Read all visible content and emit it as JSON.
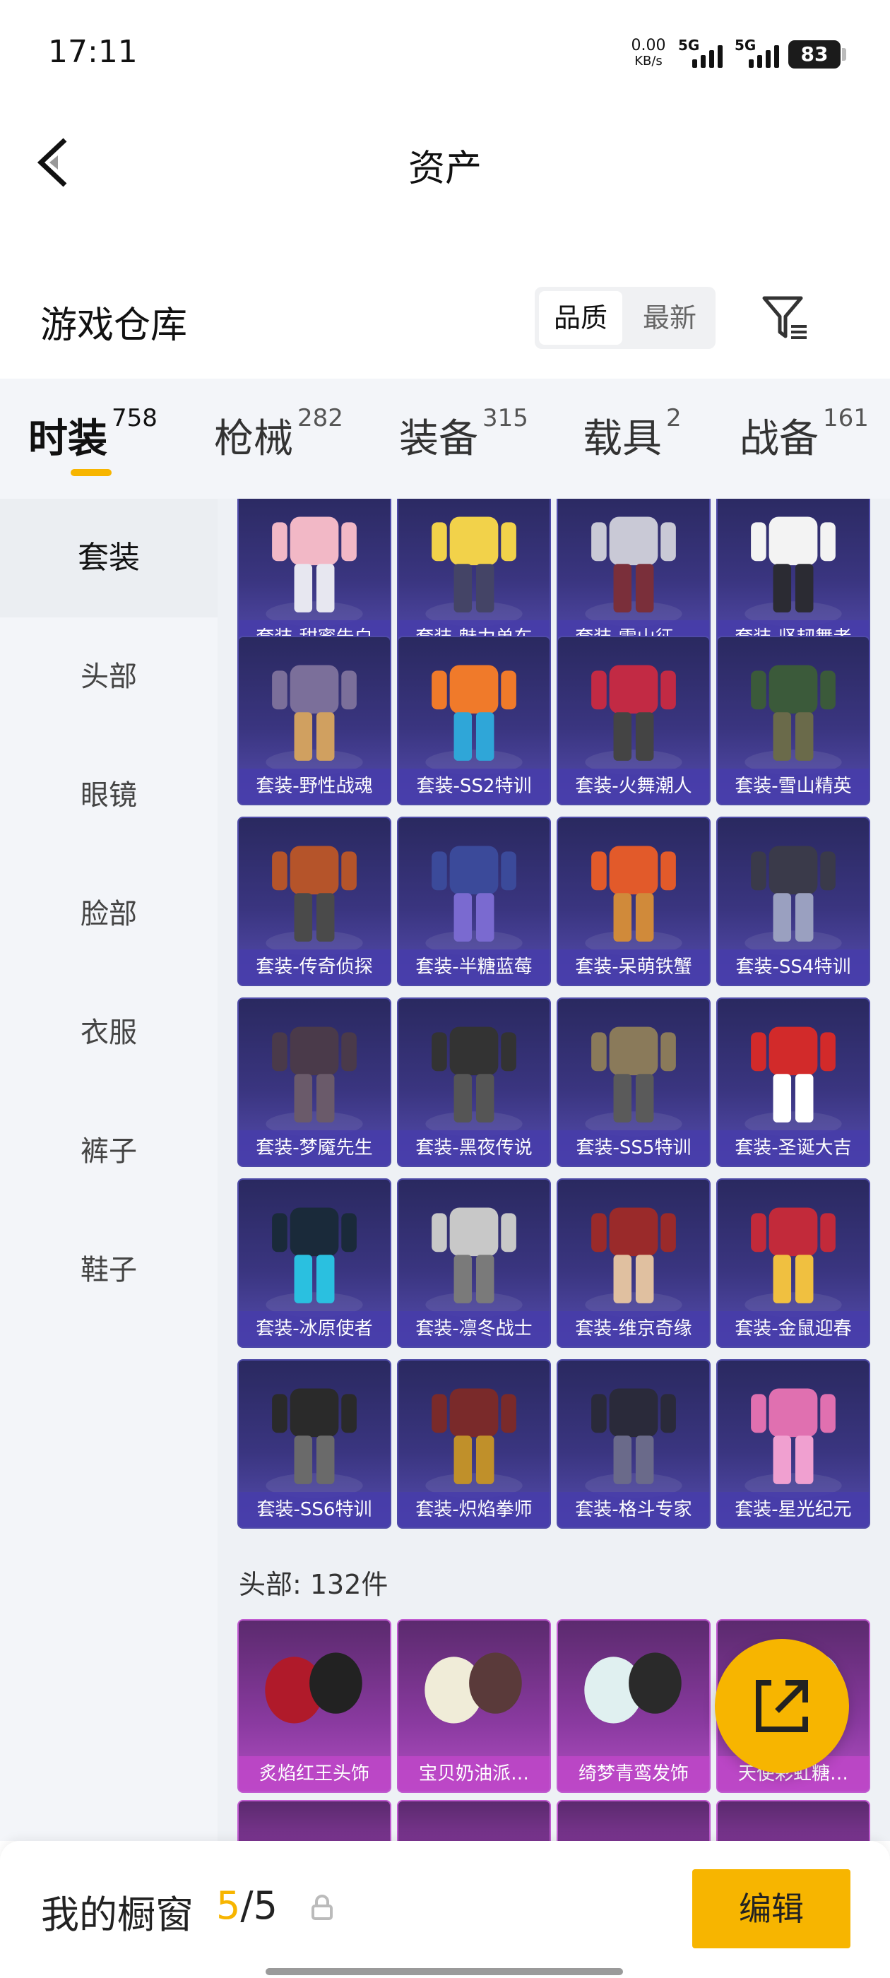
{
  "status": {
    "time": "17:11",
    "net_speed": "0.00",
    "net_unit": "KB/s",
    "signal1_label": "5G",
    "signal2_label": "5G",
    "battery": "83"
  },
  "page": {
    "title": "资产"
  },
  "warehouse": {
    "title": "游戏仓库",
    "sort_quality": "品质",
    "sort_newest": "最新"
  },
  "tabs": [
    {
      "label": "时装",
      "count": "758"
    },
    {
      "label": "枪械",
      "count": "282"
    },
    {
      "label": "装备",
      "count": "315"
    },
    {
      "label": "载具",
      "count": "2"
    },
    {
      "label": "战备",
      "count": "161"
    }
  ],
  "sidebar": [
    {
      "label": "套装"
    },
    {
      "label": "头部"
    },
    {
      "label": "眼镜"
    },
    {
      "label": "脸部"
    },
    {
      "label": "衣服"
    },
    {
      "label": "裤子"
    },
    {
      "label": "鞋子"
    }
  ],
  "suits": [
    "套装-甜蜜告白",
    "套装-魅力单车",
    "套装-雪山征…",
    "套装-坚韧舞者",
    "套装-野性战魂",
    "套装-SS2特训",
    "套装-火舞潮人",
    "套装-雪山精英",
    "套装-传奇侦探",
    "套装-半糖蓝莓",
    "套装-呆萌铁蟹",
    "套装-SS4特训",
    "套装-梦魇先生",
    "套装-黑夜传说",
    "套装-SS5特训",
    "套装-圣诞大吉",
    "套装-冰原使者",
    "套装-凛冬战士",
    "套装-维京奇缘",
    "套装-金鼠迎春",
    "套装-SS6特训",
    "套装-炽焰拳师",
    "套装-格斗专家",
    "套装-星光纪元"
  ],
  "head_section": "头部: 132件",
  "head_items": [
    "炙焰红王头饰",
    "宝贝奶油派…",
    "绮梦青鸾发饰",
    "天使彩虹糖…"
  ],
  "bottom": {
    "title": "我的橱窗",
    "current": "5",
    "separator": "/",
    "total": "5",
    "edit_label": "编辑"
  },
  "colors": {
    "accent": "#f7b500",
    "suit_card": "#3a3580",
    "head_card": "#b14fc2"
  }
}
